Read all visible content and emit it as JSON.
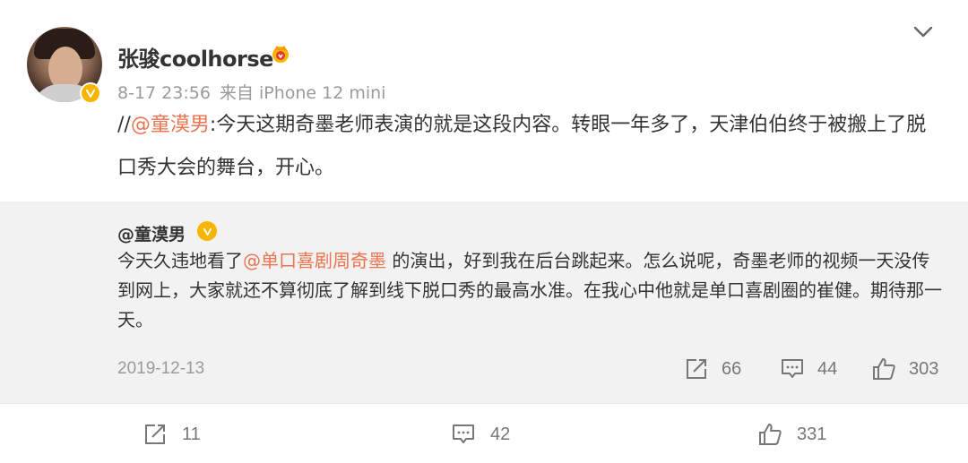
{
  "post": {
    "username": "张骏coolhorse",
    "time": "8-17 23:56",
    "source": "来自 iPhone 12 mini",
    "text_prefix": "//",
    "mention": "@童漠男",
    "text_body": ":今天这期奇墨老师表演的就是这段内容。转眼一年多了，天津伯伯终于被搬上了脱口秀大会的舞台，开心。"
  },
  "repost": {
    "author": "@童漠男",
    "text_before": "今天久违地看了",
    "mention": "@单口喜剧周奇墨",
    "text_after": " 的演出，好到我在后台跳起来。怎么说呢，奇墨老师的视频一天没传到网上，大家就还不算彻底了解到线下脱口秀的最高水准。在我心中他就是单口喜剧圈的崔健。期待那一天。",
    "date": "2019-12-13",
    "reposts": "66",
    "comments": "44",
    "likes": "303"
  },
  "bottom": {
    "reposts": "11",
    "comments": "42",
    "likes": "331"
  },
  "colors": {
    "mention": "#eb7350",
    "verify": "#f7b500",
    "meta": "#9a9a9a",
    "repost_bg": "#f2f2f2"
  },
  "icons": [
    "verified-badge-icon",
    "vip-crown-icon",
    "chevron-down-icon",
    "repost-icon",
    "comment-icon",
    "like-icon"
  ]
}
